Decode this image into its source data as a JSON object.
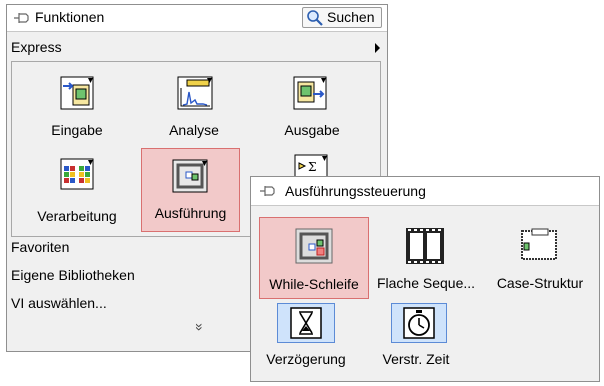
{
  "functions_palette": {
    "title": "Funktionen",
    "search_label": "Suchen",
    "category": "Express",
    "items": [
      {
        "label": "Eingabe",
        "icon": "input-vi-icon"
      },
      {
        "label": "Analyse",
        "icon": "analysis-vi-icon"
      },
      {
        "label": "Ausgabe",
        "icon": "output-vi-icon"
      },
      {
        "label": "Verarbeitung",
        "icon": "processing-vi-icon"
      },
      {
        "label": "Ausführung",
        "icon": "execution-vi-icon"
      },
      {
        "label": "",
        "icon": "arithmetic-vi-icon"
      }
    ],
    "menu": [
      "Favoriten",
      "Eigene Bibliotheken",
      "VI auswählen..."
    ],
    "more_glyph": "»"
  },
  "subpalette": {
    "title": "Ausführungssteuerung",
    "items": [
      {
        "label": "While-Schleife",
        "icon": "while-loop-icon"
      },
      {
        "label": "Flache Seque...",
        "icon": "flat-sequence-icon"
      },
      {
        "label": "Case-Struktur",
        "icon": "case-structure-icon"
      },
      {
        "label": "Verzögerung",
        "icon": "time-delay-icon"
      },
      {
        "label": "Verstr. Zeit",
        "icon": "elapsed-time-icon"
      }
    ]
  },
  "colors": {
    "highlight_red": "#f2c9c9",
    "highlight_blue": "#cfe3fb",
    "panel": "#f0f0f0"
  }
}
